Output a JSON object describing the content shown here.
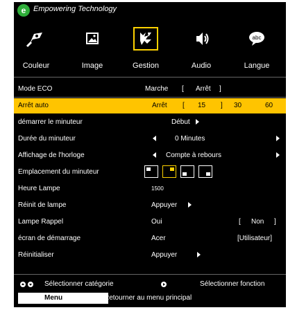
{
  "header": {
    "logo_letter": "e",
    "tagline": "Empowering Technology"
  },
  "tabs": [
    {
      "label": "Couleur",
      "icon": "color-icon"
    },
    {
      "label": "Image",
      "icon": "image-icon"
    },
    {
      "label": "Gestion",
      "icon": "management-icon",
      "selected": true
    },
    {
      "label": "Audio",
      "icon": "speaker-icon"
    },
    {
      "label": "Langue",
      "icon": "language-icon"
    }
  ],
  "rows": {
    "mode_eco": {
      "label": "Mode ECO",
      "opt1": "Marche",
      "br_open": "[",
      "opt2": "Arrêt",
      "br_close": "]"
    },
    "arret_auto": {
      "label": "Arrêt auto",
      "opt1": "Arrêt",
      "br_open": "[",
      "v15": "15",
      "br_close": "]",
      "v30": "30",
      "v60": "60"
    },
    "demarrer_minuteur": {
      "label": "démarrer le minuteur",
      "value": "Début"
    },
    "duree_minuteur": {
      "label": "Durée du minuteur",
      "value": "0 Minutes"
    },
    "affichage_horloge": {
      "label": "Affichage de l'horloge",
      "value": "Compte à rebours"
    },
    "emplacement_minuteur": {
      "label": "Emplacement du minuteur"
    },
    "heure_lampe": {
      "label": "Heure Lampe",
      "value": "1500"
    },
    "reinit_lampe": {
      "label": "Réinit de lampe",
      "value": "Appuyer"
    },
    "lampe_rappel": {
      "label": "Lampe Rappel",
      "opt1": "Oui",
      "br_open": "[",
      "opt2": "Non",
      "br_close": "]"
    },
    "ecran_demarrage": {
      "label": "écran de démarrage",
      "opt1": "Acer",
      "opt2": "[Utilisateur]"
    },
    "reinitialiser": {
      "label": "Réinitialiser",
      "value": "Appuyer"
    }
  },
  "footer": {
    "select_category": "Sélectionner catégorie",
    "select_function": "Sélectionner fonction",
    "menu_label": "Menu",
    "return_text": "Retourner au menu principal"
  },
  "colors": {
    "highlight": "#ffc400",
    "accent": "#ffd200",
    "logo": "#2fae3a"
  }
}
